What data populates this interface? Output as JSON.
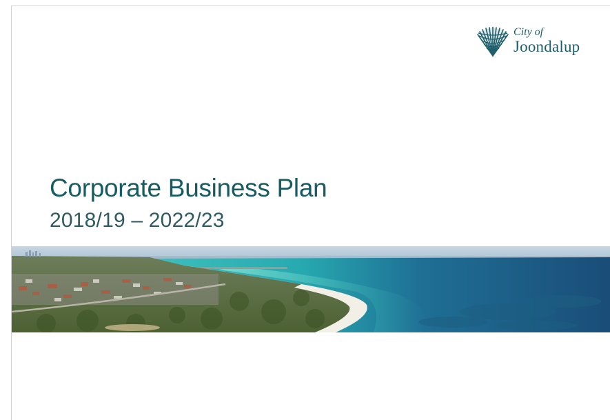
{
  "logo": {
    "line1": "City of",
    "line2": "Joondalup",
    "icon": "palm-fan-emblem-icon"
  },
  "cover": {
    "title": "Corporate Business Plan",
    "period": "2018/19 – 2022/23"
  },
  "banner": {
    "image": "aerial-coastline-photo"
  },
  "colors": {
    "brand_teal": "#175b63",
    "ocean_deep": "#1a4f78",
    "ocean_turquoise": "#2fb8b2",
    "beach_sand": "#f2efe6",
    "scrub_green": "#556b3b"
  }
}
